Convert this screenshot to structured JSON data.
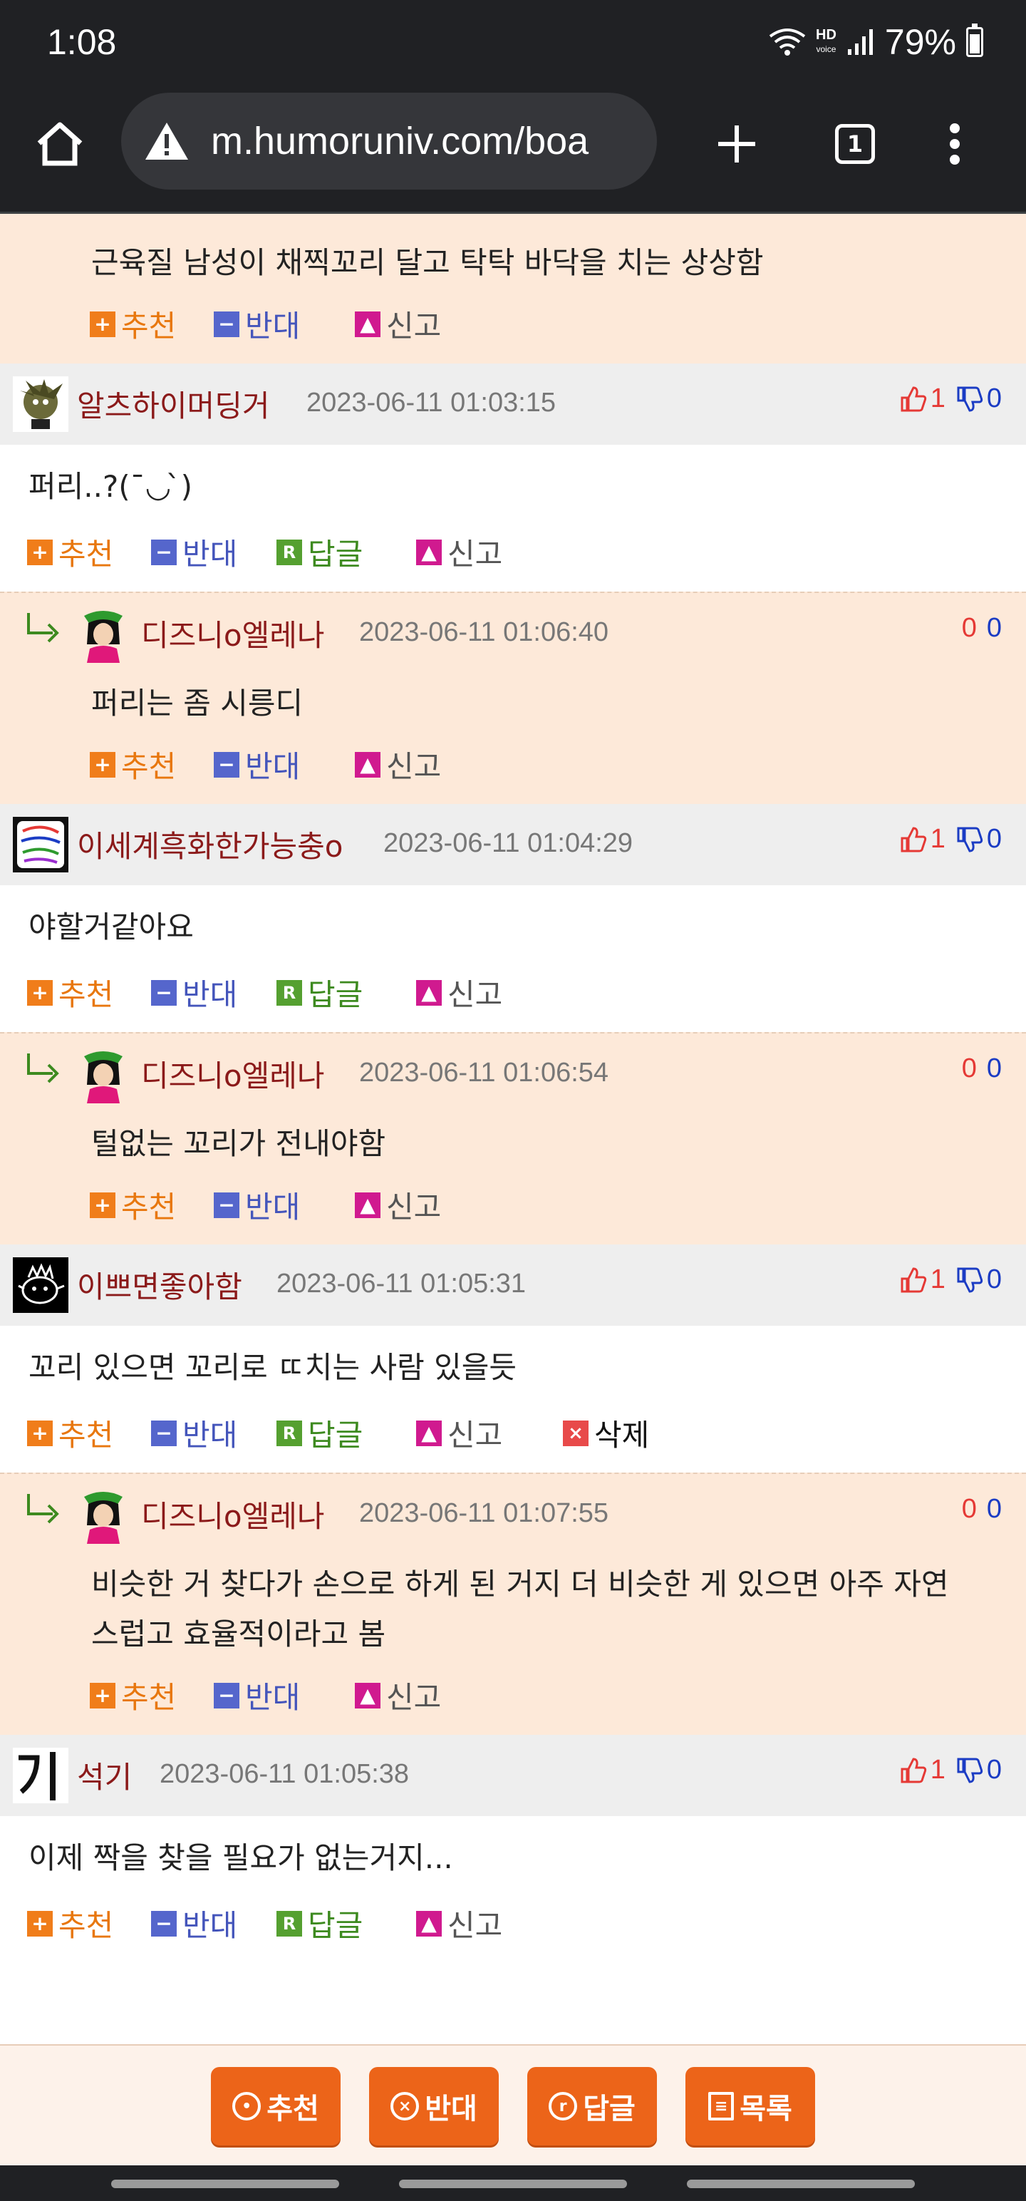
{
  "status_bar": {
    "time": "1:08",
    "hd": "HD",
    "voice": "voice",
    "battery": "79%"
  },
  "browser": {
    "url": "m.humoruniv.com/boa",
    "tab_count": "1"
  },
  "labels": {
    "recommend": "추천",
    "oppose": "반대",
    "reply": "답글",
    "report": "신고",
    "delete": "삭제"
  },
  "comments": [
    {
      "kind": "reply-tail",
      "text": "근육질 남성이 채찍꼬리 달고 탁탁 바닥을 치는 상상함"
    },
    {
      "kind": "comment",
      "nick": "알츠하이머딩거",
      "date": "2023-06-11 01:03:15",
      "up": "1",
      "down": "0",
      "text": "퍼리..?(¯◡ ̀)"
    },
    {
      "kind": "reply",
      "nick": "디즈니o엘레나",
      "date": "2023-06-11 01:06:40",
      "up": "0",
      "down": "0",
      "text": "퍼리는 좀 시릉디"
    },
    {
      "kind": "comment",
      "nick": "이세계흑화한가능충o",
      "date": "2023-06-11 01:04:29",
      "up": "1",
      "down": "0",
      "text": "야할거같아요"
    },
    {
      "kind": "reply",
      "nick": "디즈니o엘레나",
      "date": "2023-06-11 01:06:54",
      "up": "0",
      "down": "0",
      "text": "털없는 꼬리가 전내야함"
    },
    {
      "kind": "comment",
      "nick": "이쁘면좋아함",
      "date": "2023-06-11 01:05:31",
      "up": "1",
      "down": "0",
      "text": "꼬리 있으면 꼬리로 ㄸ치는 사람 있을듯"
    },
    {
      "kind": "reply",
      "nick": "디즈니o엘레나",
      "date": "2023-06-11 01:07:55",
      "up": "0",
      "down": "0",
      "text": "비슷한 거 찾다가 손으로 하게 된 거지 더 비슷한 게 있으면 아주 자연스럽고 효율적이라고 봄"
    },
    {
      "kind": "comment",
      "nick": "석기",
      "date": "2023-06-11 01:05:38",
      "up": "1",
      "down": "0",
      "text": "이제 짝을 찾을 필요가 없는거지..."
    }
  ],
  "bottom_buttons": {
    "recommend": "추천",
    "oppose": "반대",
    "reply": "답글",
    "list": "목록"
  },
  "colors": {
    "reply_bg": "#fde9d9",
    "header_bg": "#eeeeee",
    "button": "#ec6419",
    "nick": "#8b1a1a"
  }
}
